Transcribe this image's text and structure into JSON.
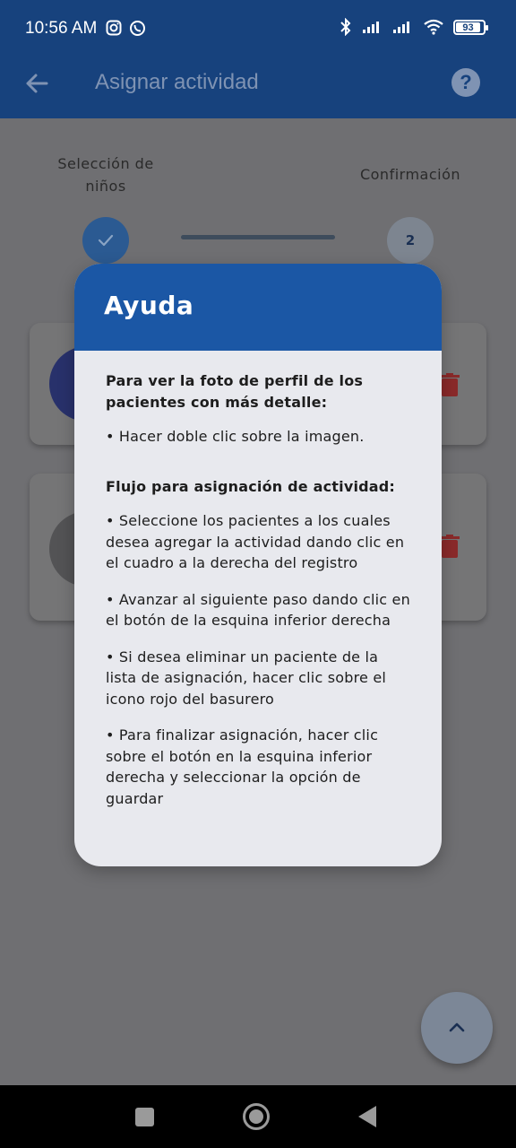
{
  "status_bar": {
    "time": "10:56 AM",
    "battery": "93",
    "left_icons": [
      "instagram-icon",
      "whatsapp-icon"
    ],
    "right_icons": [
      "bluetooth-icon",
      "signal-icon",
      "signal-icon",
      "wifi-icon",
      "battery-icon"
    ]
  },
  "app_bar": {
    "title": "Asignar actividad",
    "back_icon": "arrow-left-icon",
    "help_icon": "help-circle-icon"
  },
  "stepper": {
    "step1_label": "Selección de niños",
    "step2_label": "Confirmación",
    "step2_number": "2"
  },
  "dialog": {
    "title": "Ayuda",
    "section1_heading": "Para ver la foto de perfil de los pacientes con más detalle:",
    "section1_item": "• Hacer doble clic sobre la imagen.",
    "section2_heading": "Flujo para asignación de actividad:",
    "items": [
      "• Seleccione los pacientes a los cuales desea agregar la actividad dando clic en el cuadro a la derecha del registro",
      "• Avanzar al siguiente paso dando clic en el botón de la esquina inferior derecha",
      "• Si desea eliminar un paciente de la lista de asignación, hacer clic sobre el icono rojo del basurero",
      "• Para finalizar asignación, hacer clic sobre el botón en la esquina inferior derecha y seleccionar la opción de guardar"
    ]
  },
  "colors": {
    "app_bar": "#17427d",
    "dialog_header": "#1b57a5",
    "dialog_body": "#e8e9ee",
    "trash": "#b22a2a"
  }
}
